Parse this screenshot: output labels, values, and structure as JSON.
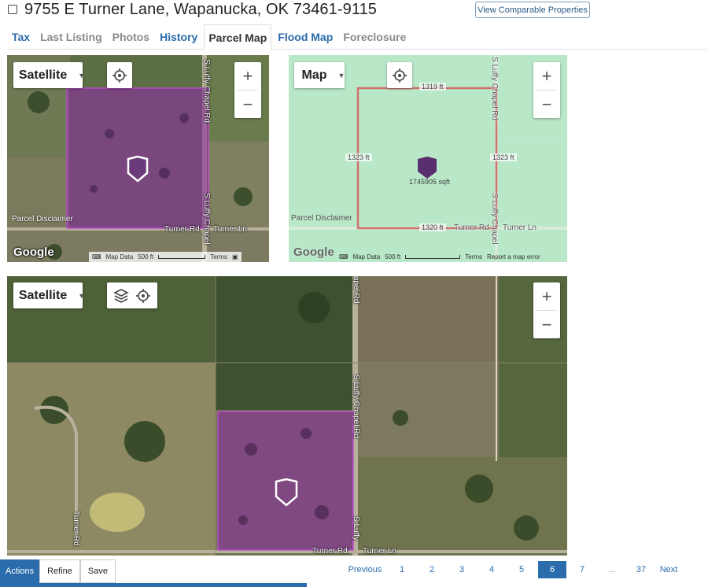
{
  "header": {
    "address": "9755 E Turner Lane, Wapanucka, OK 73461-9115",
    "compare_button": "View Comparable Properties"
  },
  "tabs": [
    {
      "label": "Tax"
    },
    {
      "label": "Last Listing"
    },
    {
      "label": "Photos"
    },
    {
      "label": "History"
    },
    {
      "label": "Parcel Map"
    },
    {
      "label": "Flood Map"
    },
    {
      "label": "Foreclosure"
    }
  ],
  "map_satellite_small": {
    "type_label": "Satellite",
    "road_vertical": "S Luffy Chapel Rd",
    "road_vertical_2": "S Luffy Chapel",
    "road_turner_rd": "Turner Rd",
    "road_turner_ln": "Turner Ln",
    "disclaimer": "Parcel Disclaimer",
    "logo": "Google",
    "map_data": "Map Data",
    "scale": "500 ft",
    "terms": "Terms"
  },
  "map_road": {
    "type_label": "Map",
    "road_vertical": "S Luffy Chapel Rd",
    "road_vertical_2": "S Luffy Chapel",
    "road_turner_rd": "Turner Rd",
    "road_turner_ln": "Turner Ln",
    "dim_top": "1319 ft",
    "dim_left": "1323 ft",
    "dim_right": "1323 ft",
    "dim_bottom": "1320 ft",
    "area": "1745905 sqft",
    "disclaimer": "Parcel Disclaimer",
    "logo": "Google",
    "map_data": "Map Data",
    "scale": "500 ft",
    "terms": "Terms",
    "report": "Report a map error"
  },
  "map_satellite_large": {
    "type_label": "Satellite",
    "road_chapel_top": "apel Rd",
    "road_chapel_mid": "S Luffy Chapel Rd",
    "road_chapel_bottom": "S Luffy",
    "road_turner_rd": "Turner Rd",
    "road_turner_bottom": "Turner Rd",
    "road_turner_ln": "Turner Ln"
  },
  "actions": {
    "actions": "Actions",
    "refine": "Refine",
    "save": "Save"
  },
  "pager": {
    "previous": "Previous",
    "pages": [
      "1",
      "2",
      "3",
      "4",
      "5",
      "6",
      "7",
      "...",
      "37"
    ],
    "current": "6",
    "next": "Next"
  },
  "colors": {
    "accent": "#2a6cac",
    "parcel_fill": "#8a2fa0",
    "parcel_outline": "#c94040",
    "marker": "#5a2f6e"
  }
}
